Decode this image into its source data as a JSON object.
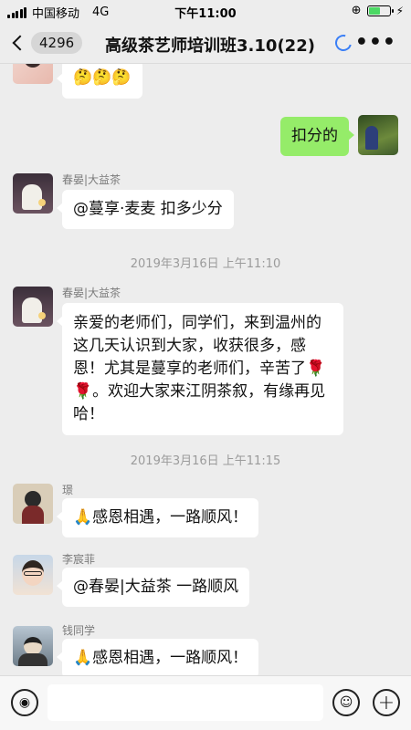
{
  "status_bar": {
    "carrier": "中国移动",
    "network": "4G",
    "time": "下午11:00",
    "battery_level": 0.55
  },
  "nav": {
    "unread_count": "4296",
    "title": "高级茶艺师培训班3.10(22)",
    "more_label": "•••"
  },
  "messages": [
    {
      "sender": "",
      "text": "🤔🤔🤔",
      "side": "left"
    },
    {
      "sender": "",
      "text": "扣分的",
      "side": "right"
    },
    {
      "sender": "春晏|大益茶",
      "text": "@蔓享·麦麦 扣多少分",
      "side": "left"
    },
    {
      "timestamp": "2019年3月16日 上午11:10"
    },
    {
      "sender": "春晏|大益茶",
      "text": "亲爱的老师们，同学们，来到温州的这几天认识到大家，收获很多，感恩！尤其是蔓享的老师们，辛苦了🌹🌹。欢迎大家来江阴茶叙，有缘再见哈！",
      "side": "left"
    },
    {
      "timestamp": "2019年3月16日 上午11:15"
    },
    {
      "sender": "璟",
      "text": "🙏感恩相遇，一路顺风！",
      "side": "left"
    },
    {
      "sender": "李宸菲",
      "text": "@春晏|大益茶 一路顺风",
      "side": "left"
    },
    {
      "sender": "钱同学",
      "text": "🙏感恩相遇，一路顺风！",
      "side": "left"
    }
  ],
  "input_bar": {
    "voice_icon": "voice-icon",
    "emoji_icon": "emoji-icon",
    "plus_label": "+"
  }
}
